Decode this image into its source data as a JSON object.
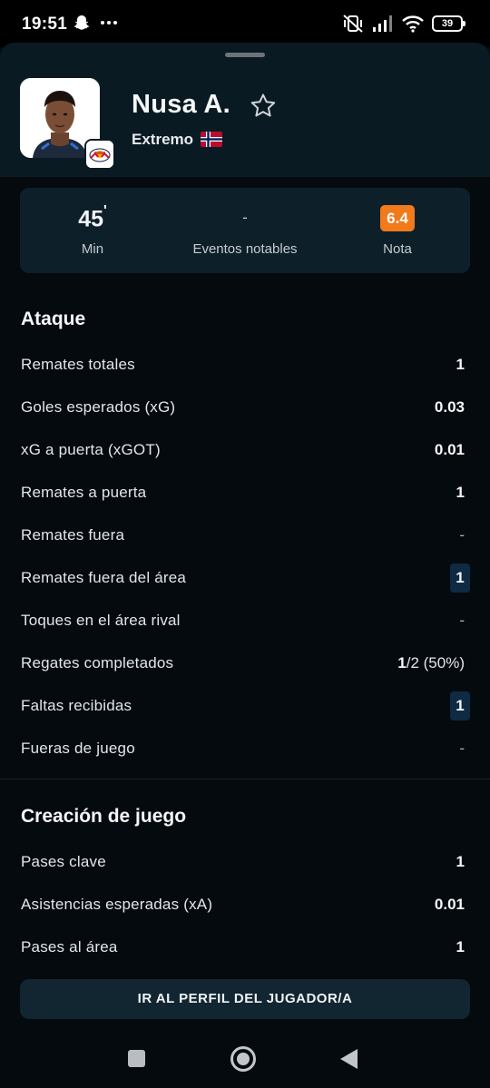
{
  "status_bar": {
    "time": "19:51",
    "battery": "39",
    "icons": [
      "snapchat-icon",
      "more-dots-icon",
      "mute-vibrate-icon",
      "signal-icon",
      "wifi-icon",
      "battery-icon"
    ]
  },
  "player": {
    "name": "Nusa A.",
    "position": "Extremo",
    "flag": "norway-flag-icon",
    "team_badge": "rb-leipzig-badge"
  },
  "summary": {
    "minutes_value": "45",
    "minutes_suffix": "'",
    "minutes_label": "Min",
    "events_value": "-",
    "events_label": "Eventos notables",
    "rating_value": "6.4",
    "rating_label": "Nota",
    "rating_color": "#f17a1b"
  },
  "attack": {
    "title": "Ataque",
    "rows": [
      {
        "label": "Remates totales",
        "value": "1"
      },
      {
        "label": "Goles esperados (xG)",
        "value": "0.03"
      },
      {
        "label": "xG a puerta (xGOT)",
        "value": "0.01"
      },
      {
        "label": "Remates a puerta",
        "value": "1"
      },
      {
        "label": "Remates fuera",
        "value": "-"
      },
      {
        "label": "Remates fuera del área",
        "value": "1"
      },
      {
        "label": "Toques en el área rival",
        "value": "-"
      },
      {
        "label": "Regates completados",
        "value_bold": "1",
        "value_rest": "/2 (50%)"
      },
      {
        "label": "Faltas recibidas",
        "value": "1"
      },
      {
        "label": "Fueras de juego",
        "value": "-"
      }
    ]
  },
  "creation": {
    "title": "Creación de juego",
    "rows": [
      {
        "label": "Pases clave",
        "value": "1"
      },
      {
        "label": "Asistencias esperadas (xA)",
        "value": "0.01"
      },
      {
        "label": "Pases al área",
        "value": "1"
      }
    ]
  },
  "profile_button": "IR AL PERFIL DEL JUGADOR/A",
  "colors": {
    "background": "#050a0f",
    "header": "#0a1a22",
    "card": "#0d2029",
    "highlight_pill": "#0f2a43"
  }
}
